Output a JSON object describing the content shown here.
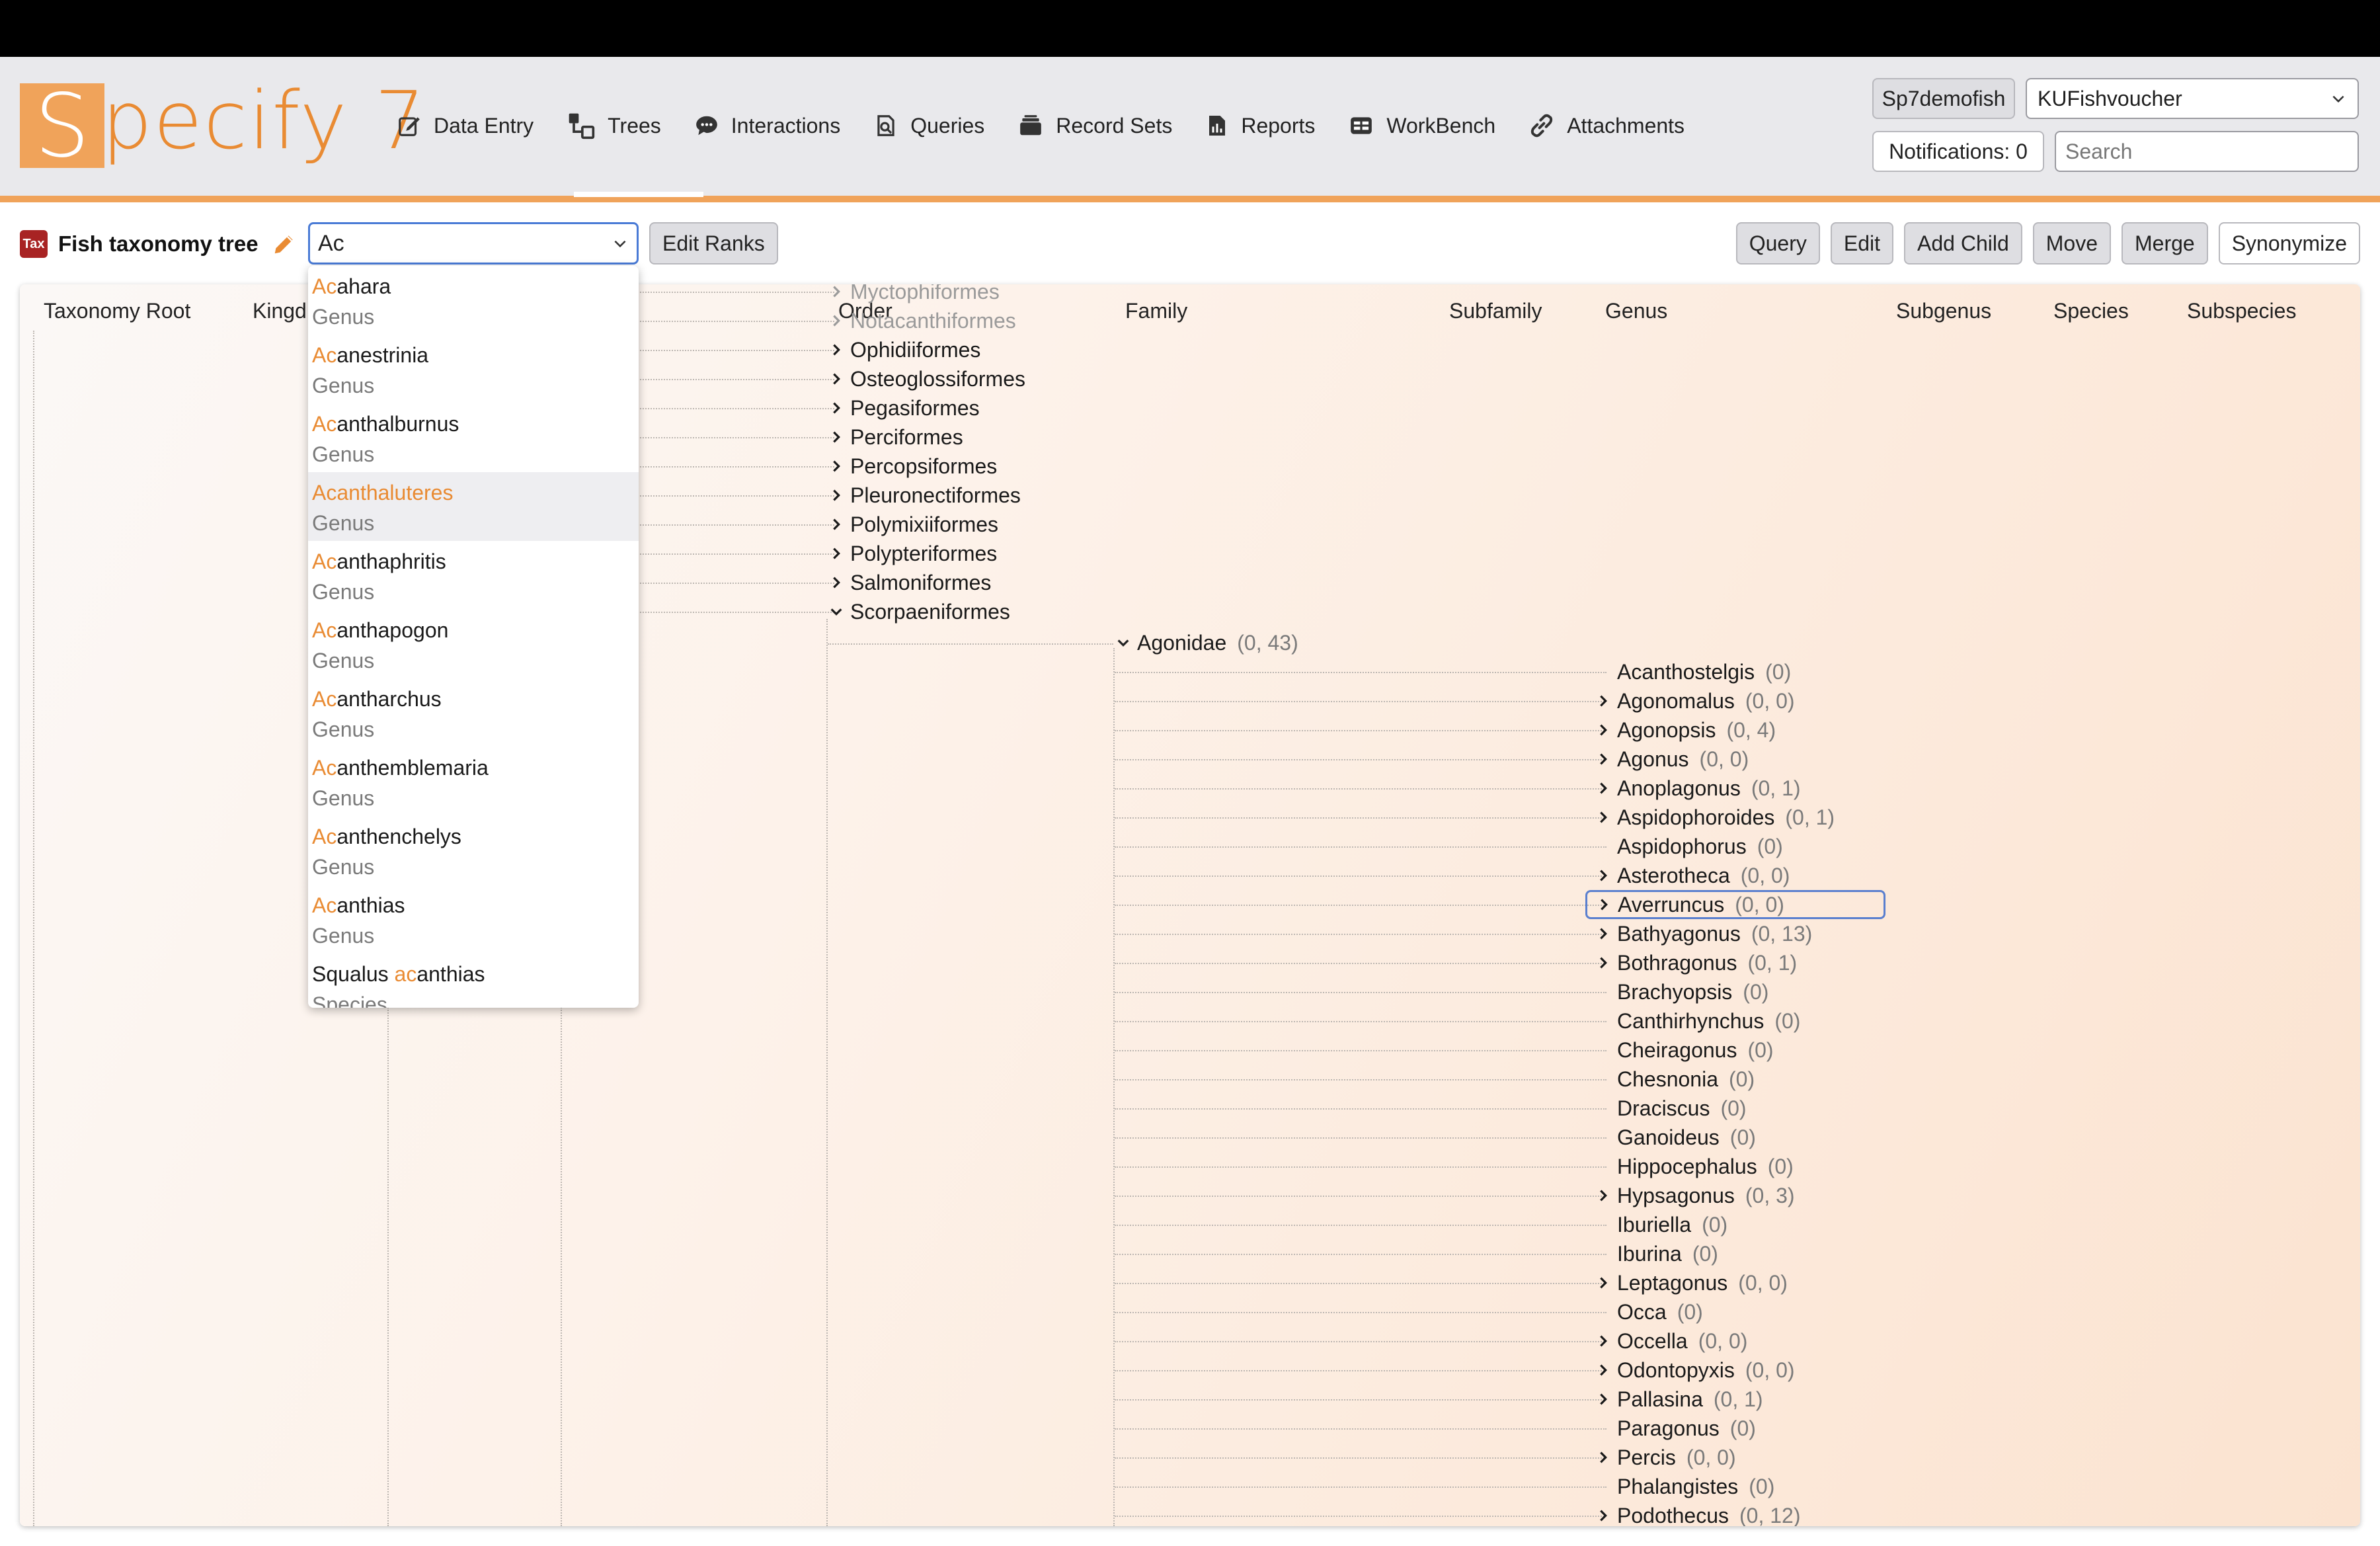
{
  "app": {
    "logo_text": "Specify 7",
    "logo_initial": "S",
    "logo_rest": "pecify 7"
  },
  "nav": [
    {
      "label": "Data Entry",
      "icon": "edit-icon"
    },
    {
      "label": "Trees",
      "icon": "tree-icon"
    },
    {
      "label": "Interactions",
      "icon": "chat-icon"
    },
    {
      "label": "Queries",
      "icon": "query-icon"
    },
    {
      "label": "Record Sets",
      "icon": "record-sets-icon"
    },
    {
      "label": "Reports",
      "icon": "report-icon"
    },
    {
      "label": "WorkBench",
      "icon": "workbench-icon"
    },
    {
      "label": "Attachments",
      "icon": "attachment-icon"
    }
  ],
  "header": {
    "user_label": "Sp7demofish",
    "collection_value": "KUFishvoucher",
    "notifications_label": "Notifications: 0",
    "search_placeholder": "Search"
  },
  "tree": {
    "badge": "Tax",
    "title": "Fish taxonomy tree",
    "search_value": "Ac",
    "edit_ranks_label": "Edit Ranks",
    "actions": {
      "query": "Query",
      "edit": "Edit",
      "add_child": "Add Child",
      "move": "Move",
      "merge": "Merge",
      "synonymize": "Synonymize"
    },
    "ranks": [
      "Taxonomy Root",
      "Kingd",
      "Order",
      "Family",
      "Subfamily",
      "Genus",
      "Subgenus",
      "Species",
      "Subspecies"
    ],
    "orders": [
      {
        "name": "Myctophiformes",
        "faded": true
      },
      {
        "name": "Notacanthiformes",
        "faded": true
      },
      {
        "name": "Ophidiiformes"
      },
      {
        "name": "Osteoglossiformes"
      },
      {
        "name": "Pegasiformes"
      },
      {
        "name": "Perciformes"
      },
      {
        "name": "Percopsiformes"
      },
      {
        "name": "Pleuronectiformes"
      },
      {
        "name": "Polymixiiformes"
      },
      {
        "name": "Polypteriformes"
      },
      {
        "name": "Salmoniformes"
      },
      {
        "name": "Scorpaeniformes",
        "expanded": true
      }
    ],
    "family": {
      "name": "Agonidae",
      "count": "(0, 43)"
    },
    "genera": [
      {
        "name": "Acanthostelgis",
        "count": "(0)",
        "expandable": false
      },
      {
        "name": "Agonomalus",
        "count": "(0, 0)",
        "expandable": true
      },
      {
        "name": "Agonopsis",
        "count": "(0, 4)",
        "expandable": true
      },
      {
        "name": "Agonus",
        "count": "(0, 0)",
        "expandable": true
      },
      {
        "name": "Anoplagonus",
        "count": "(0, 1)",
        "expandable": true
      },
      {
        "name": "Aspidophoroides",
        "count": "(0, 1)",
        "expandable": true
      },
      {
        "name": "Aspidophorus",
        "count": "(0)",
        "expandable": false
      },
      {
        "name": "Asterotheca",
        "count": "(0, 0)",
        "expandable": true
      },
      {
        "name": "Averruncus",
        "count": "(0, 0)",
        "expandable": true,
        "selected": true
      },
      {
        "name": "Bathyagonus",
        "count": "(0, 13)",
        "expandable": true
      },
      {
        "name": "Bothragonus",
        "count": "(0, 1)",
        "expandable": true
      },
      {
        "name": "Brachyopsis",
        "count": "(0)",
        "expandable": false
      },
      {
        "name": "Canthirhynchus",
        "count": "(0)",
        "expandable": false
      },
      {
        "name": "Cheiragonus",
        "count": "(0)",
        "expandable": false
      },
      {
        "name": "Chesnonia",
        "count": "(0)",
        "expandable": false
      },
      {
        "name": "Draciscus",
        "count": "(0)",
        "expandable": false
      },
      {
        "name": "Ganoideus",
        "count": "(0)",
        "expandable": false
      },
      {
        "name": "Hippocephalus",
        "count": "(0)",
        "expandable": false
      },
      {
        "name": "Hypsagonus",
        "count": "(0, 3)",
        "expandable": true
      },
      {
        "name": "Iburiella",
        "count": "(0)",
        "expandable": false
      },
      {
        "name": "Iburina",
        "count": "(0)",
        "expandable": false
      },
      {
        "name": "Leptagonus",
        "count": "(0, 0)",
        "expandable": true
      },
      {
        "name": "Occa",
        "count": "(0)",
        "expandable": false
      },
      {
        "name": "Occella",
        "count": "(0, 0)",
        "expandable": true
      },
      {
        "name": "Odontopyxis",
        "count": "(0, 0)",
        "expandable": true
      },
      {
        "name": "Pallasina",
        "count": "(0, 1)",
        "expandable": true
      },
      {
        "name": "Paragonus",
        "count": "(0)",
        "expandable": false
      },
      {
        "name": "Percis",
        "count": "(0, 0)",
        "expandable": true
      },
      {
        "name": "Phalangistes",
        "count": "(0)",
        "expandable": false
      },
      {
        "name": "Podothecus",
        "count": "(0, 12)",
        "expandable": true
      }
    ]
  },
  "autocomplete": [
    {
      "pre": "",
      "match": "Ac",
      "post": "ahara",
      "rank": "Genus"
    },
    {
      "pre": "",
      "match": "Ac",
      "post": "anestrinia",
      "rank": "Genus"
    },
    {
      "pre": "",
      "match": "Ac",
      "post": "anthalburnus",
      "rank": "Genus"
    },
    {
      "pre": "",
      "match": "Ac",
      "post": "anthaluteres",
      "rank": "Genus",
      "highlighted": true
    },
    {
      "pre": "",
      "match": "Ac",
      "post": "anthaphritis",
      "rank": "Genus"
    },
    {
      "pre": "",
      "match": "Ac",
      "post": "anthapogon",
      "rank": "Genus"
    },
    {
      "pre": "",
      "match": "Ac",
      "post": "antharchus",
      "rank": "Genus"
    },
    {
      "pre": "",
      "match": "Ac",
      "post": "anthemblemaria",
      "rank": "Genus"
    },
    {
      "pre": "",
      "match": "Ac",
      "post": "anthenchelys",
      "rank": "Genus"
    },
    {
      "pre": "",
      "match": "Ac",
      "post": "anthias",
      "rank": "Genus"
    },
    {
      "pre": "Squalus ",
      "match": "ac",
      "post": "anthias",
      "rank": "Species"
    }
  ],
  "colors": {
    "accent": "#e98b33",
    "header_bg": "#e9e9ec",
    "selection": "#5a7fcf",
    "tax_badge": "#a82323"
  }
}
